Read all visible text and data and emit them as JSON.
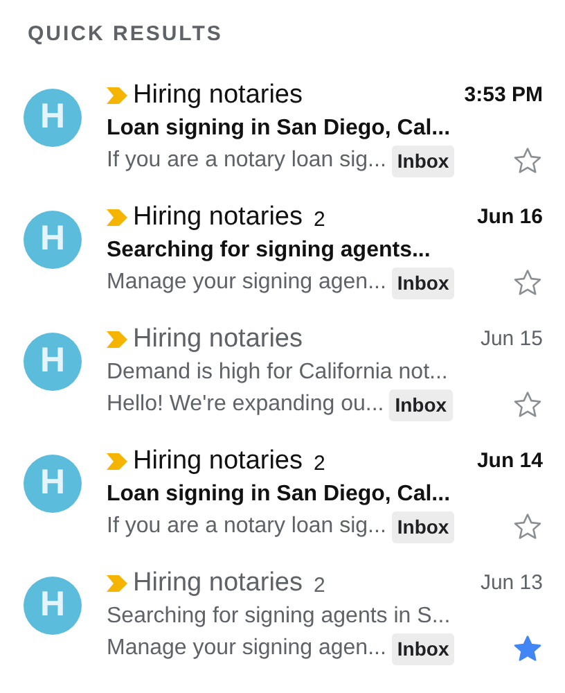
{
  "section_title": "QUICK RESULTS",
  "messages": [
    {
      "avatar": "H",
      "important": true,
      "sender": "Hiring notaries",
      "time": "3:53 PM",
      "subject": "Loan signing in San Diego, Cal...",
      "snippet": "If you are a notary loan sig...",
      "label": "Inbox",
      "unread": true,
      "starred": false
    },
    {
      "avatar": "H",
      "important": true,
      "sender": "Hiring notaries",
      "count": "2",
      "time": "Jun 16",
      "subject": "Searching for signing agents...",
      "snippet": "Manage your signing agen...",
      "label": "Inbox",
      "unread": true,
      "starred": false
    },
    {
      "avatar": "H",
      "important": true,
      "sender": "Hiring notaries",
      "time": "Jun 15",
      "subject": "Demand is high for California not...",
      "snippet": "Hello! We're expanding ou...",
      "label": "Inbox",
      "unread": false,
      "starred": false
    },
    {
      "avatar": "H",
      "important": true,
      "sender": "Hiring notaries",
      "count": "2",
      "time": "Jun 14",
      "subject": "Loan signing in San Diego, Cal...",
      "snippet": "If you are a notary loan sig...",
      "label": "Inbox",
      "unread": true,
      "starred": false
    },
    {
      "avatar": "H",
      "important": true,
      "sender": "Hiring notaries",
      "count": "2",
      "time": "Jun 13",
      "subject": "Searching for signing agents in S...",
      "snippet": "Manage your signing agen...",
      "label": "Inbox",
      "unread": false,
      "starred": true
    }
  ]
}
